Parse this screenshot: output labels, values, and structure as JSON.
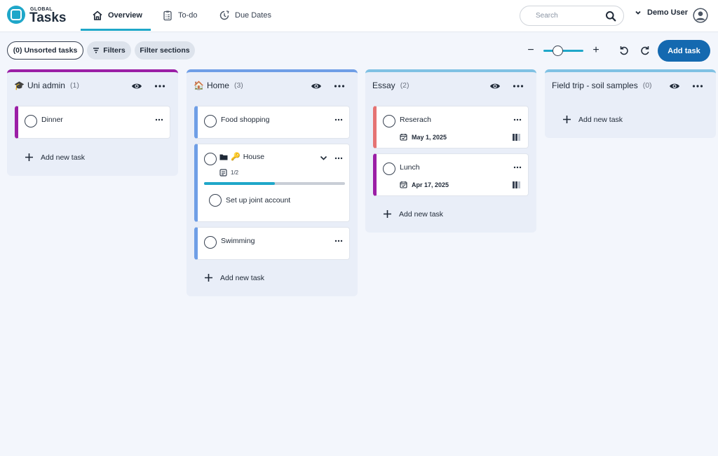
{
  "brand": {
    "small": "GLOBAL",
    "big": "Tasks"
  },
  "nav": [
    {
      "label": "Overview",
      "icon": "home-icon"
    },
    {
      "label": "To-do",
      "icon": "clipboard-list-icon"
    },
    {
      "label": "Due Dates",
      "icon": "calendar-clock-icon"
    }
  ],
  "search": {
    "placeholder": "Search"
  },
  "user": {
    "name": "Demo User"
  },
  "toolbar": {
    "unsorted_label": "(0) Unsorted tasks",
    "filters_label": "Filters",
    "filter_sections_label": "Filter sections",
    "zoom_minus": "−",
    "zoom_plus": "+",
    "zoom_level": 0.35,
    "add_task_label": "Add task"
  },
  "colors": {
    "accent": "#1fa7c9",
    "primary_button": "#1469b0",
    "uni_admin": "#9b1ea6",
    "home": "#6f9ee6",
    "essay": "#7fc1e3",
    "field_trip": "#7fc1e3",
    "research_card": "#e57373",
    "lunch_card": "#9b1ea6"
  },
  "columns": [
    {
      "emoji": "🎓",
      "title": "Uni admin",
      "count": "(1)",
      "add_label": "Add new task",
      "tasks": [
        {
          "title": "Dinner"
        }
      ]
    },
    {
      "emoji": "🏠",
      "title": "Home",
      "count": "(3)",
      "add_label": "Add new task",
      "tasks": [
        {
          "title": "Food shopping"
        },
        {
          "title": "House",
          "subtasks_progress": "1/2",
          "progress": 0.5,
          "subtask": "Set up joint account"
        },
        {
          "title": "Swimming"
        }
      ]
    },
    {
      "emoji": "",
      "title": "Essay",
      "count": "(2)",
      "add_label": "Add new task",
      "tasks": [
        {
          "title": "Reserach",
          "date": "May 1, 2025"
        },
        {
          "title": "Lunch",
          "date": "Apr 17, 2025"
        }
      ]
    },
    {
      "emoji": "",
      "title": "Field trip - soil samples",
      "count": "(0)",
      "add_label": "Add new task",
      "tasks": []
    }
  ]
}
